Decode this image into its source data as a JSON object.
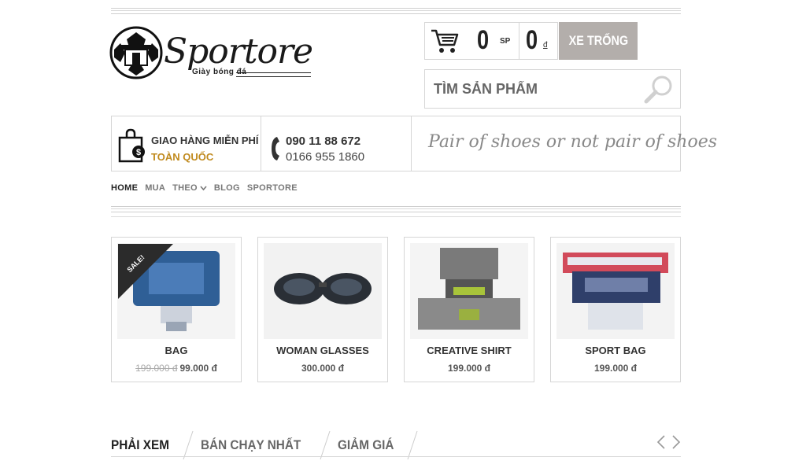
{
  "brand": {
    "name": "Sportore",
    "tagline": "Giày bóng đá"
  },
  "cart": {
    "count": "0",
    "count_unit": "SP",
    "total": "0",
    "currency": "đ",
    "button_label": "XE TRỐNG"
  },
  "search": {
    "placeholder": "TÌM SẢN PHẨM"
  },
  "info": {
    "shipping_line1": "GIAO HÀNG MIỄN PHÍ",
    "shipping_line2": "TOÀN QUỐC",
    "phone1": "090 11 88 672",
    "phone2": "0166 955 1860",
    "slogan": "Pair of shoes or not pair of shoes"
  },
  "nav": {
    "items": [
      "HOME",
      "MUA",
      "THEO",
      "BLOG",
      "SPORTORE"
    ],
    "active": "HOME"
  },
  "products": [
    {
      "name": "BAG",
      "old_price": "199.000 đ",
      "price": "99.000 đ",
      "badge": "SALE!"
    },
    {
      "name": "WOMAN GLASSES",
      "price": "300.000 đ"
    },
    {
      "name": "CREATIVE SHIRT",
      "price": "199.000 đ"
    },
    {
      "name": "SPORT BAG",
      "price": "199.000 đ"
    }
  ],
  "tabs": [
    "PHẢI XEM",
    "BÁN CHẠY NHẤT",
    "GIẢM GIÁ"
  ],
  "colors": {
    "accent_gold": "#c08a1e",
    "cart_button": "#b3aeab",
    "sale_badge": "#2b2b2b"
  }
}
